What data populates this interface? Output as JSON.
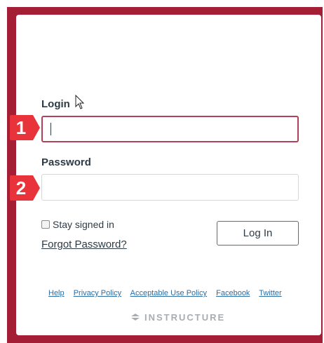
{
  "form": {
    "login_label": "Login",
    "login_value": "",
    "password_label": "Password",
    "password_value": "",
    "stay_signed_in_label": "Stay signed in",
    "stay_signed_in_checked": false,
    "forgot_password": "Forgot Password?",
    "login_button": "Log In"
  },
  "annotations": {
    "step1": "1",
    "step2": "2",
    "step_color": "#e8333a"
  },
  "footer": {
    "links": [
      "Help",
      "Privacy Policy",
      "Acceptable Use Policy",
      "Facebook",
      "Twitter"
    ]
  },
  "brand": {
    "name": "INSTRUCTURE",
    "icon": "instructure-logo-icon"
  },
  "colors": {
    "frame": "#a41e35",
    "focus_border": "#b14058"
  }
}
